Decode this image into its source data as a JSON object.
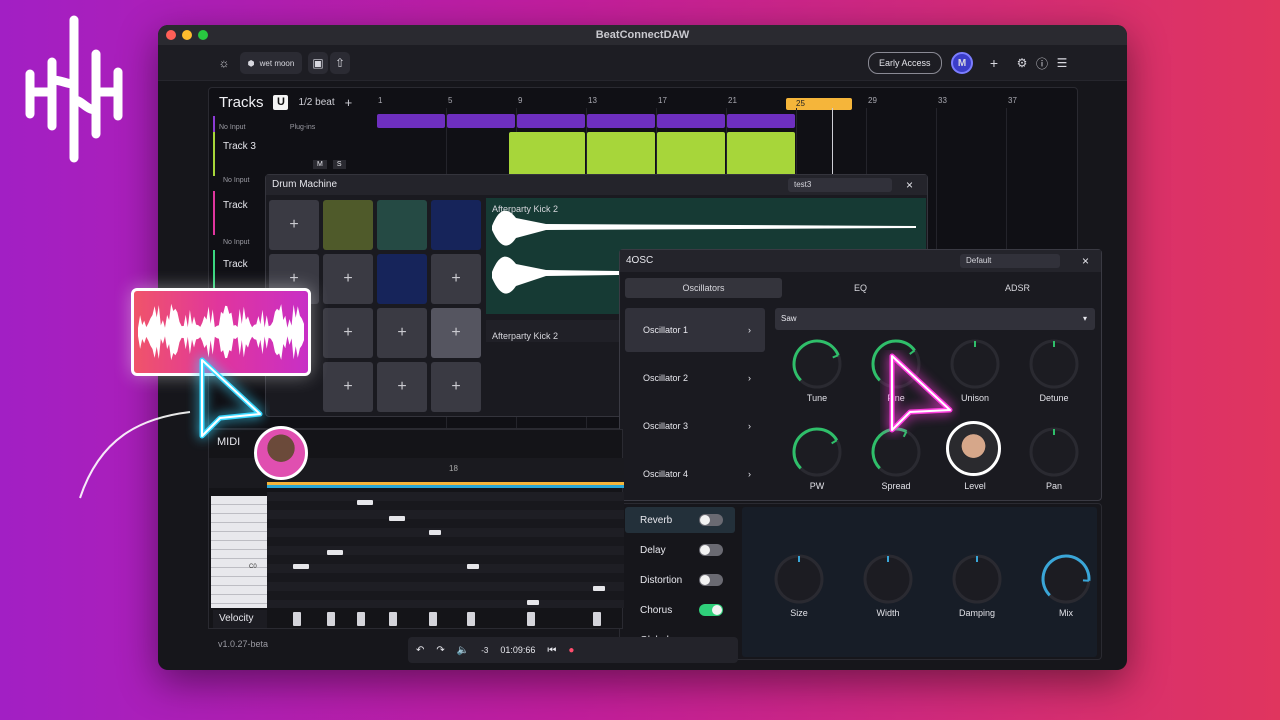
{
  "window": {
    "title": "BeatConnectDAW"
  },
  "toolbar": {
    "project_name": "wet moon",
    "early_access": "Early Access",
    "avatar_letter": "M"
  },
  "tracks": {
    "title": "Tracks",
    "badge": "U",
    "grid": "1/2 beat",
    "ruler": [
      "1",
      "5",
      "9",
      "13",
      "17",
      "21",
      "25",
      "29",
      "33",
      "37"
    ],
    "rows": [
      {
        "input": "No Input",
        "plugins": "Plug-ins"
      },
      {
        "name": "Track 3",
        "mute": "M",
        "solo": "S",
        "input": "No Input"
      },
      {
        "name": "Track",
        "input": "No Input"
      },
      {
        "name": "Track"
      }
    ]
  },
  "drum_machine": {
    "title": "Drum Machine",
    "preset": "test3",
    "sample_top": "Afterparty Kick 2",
    "sample_bottom": "Afterparty Kick 2",
    "pad_symbol": "+"
  },
  "osc": {
    "title": "4OSC",
    "preset": "Default",
    "tabs": [
      "Oscillators",
      "EQ",
      "ADSR"
    ],
    "oscillators": [
      "Oscillator 1",
      "Oscillator 2",
      "Oscillator 3",
      "Oscillator 4"
    ],
    "waveform": "Saw",
    "knobs_row1": [
      {
        "label": "Tune",
        "value": 0.75
      },
      {
        "label": "Fine",
        "value": 0.7
      },
      {
        "label": "Unison",
        "value": 0.5
      },
      {
        "label": "Detune",
        "value": 0.5
      }
    ],
    "knobs_row2": [
      {
        "label": "PW",
        "value": 0.72
      },
      {
        "label": "Spread",
        "value": 0.6
      },
      {
        "label": "Level",
        "value": 0.5
      },
      {
        "label": "Pan",
        "value": 0.5
      }
    ]
  },
  "effects": {
    "items": [
      {
        "label": "Reverb",
        "on": false
      },
      {
        "label": "Delay",
        "on": false
      },
      {
        "label": "Distortion",
        "on": false
      },
      {
        "label": "Chorus",
        "on": true
      },
      {
        "label": "Global",
        "on": null
      }
    ],
    "knobs": [
      {
        "label": "Size",
        "value": 0.5
      },
      {
        "label": "Width",
        "value": 0.5
      },
      {
        "label": "Damping",
        "value": 0.5
      },
      {
        "label": "Mix",
        "value": 0.85
      }
    ]
  },
  "midi": {
    "title": "MIDI",
    "bar_label": "18",
    "key_label": "C0",
    "velocity": "Velocity"
  },
  "transport": {
    "volume": "-3",
    "time": "01:09:66"
  },
  "version": "v1.0.27-beta",
  "colors": {
    "accent_green": "#a7d63a",
    "knob_green": "#2fbf6a",
    "loop_yellow": "#f5b53a",
    "clip_purple": "#6e2fbf"
  }
}
